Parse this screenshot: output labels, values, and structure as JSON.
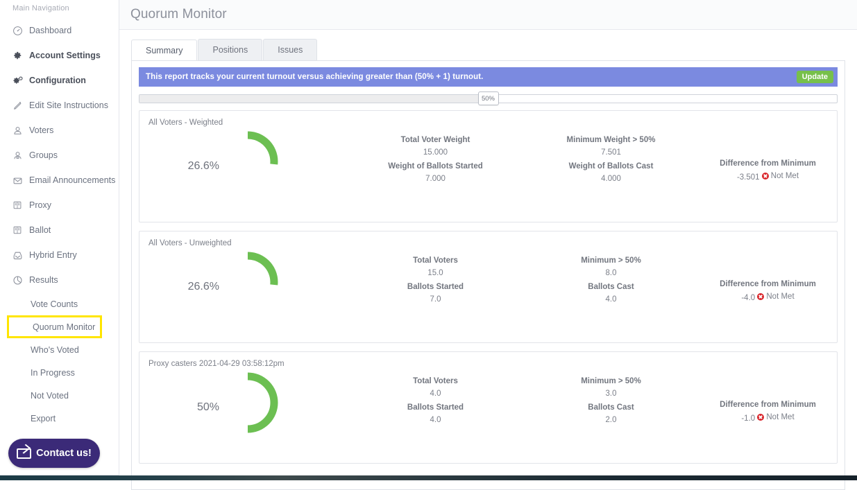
{
  "sidebar": {
    "heading": "Main Navigation",
    "items": [
      {
        "label": "Dashboard",
        "icon": "gauge-icon"
      },
      {
        "label": "Account Settings",
        "icon": "gear-icon"
      },
      {
        "label": "Configuration",
        "icon": "gears-icon"
      },
      {
        "label": "Edit Site Instructions",
        "icon": "pencil-icon"
      },
      {
        "label": "Voters",
        "icon": "user-icon"
      },
      {
        "label": "Groups",
        "icon": "users-icon"
      },
      {
        "label": "Email Announcements",
        "icon": "envelope-icon"
      },
      {
        "label": "Proxy",
        "icon": "book-icon"
      },
      {
        "label": "Ballot",
        "icon": "book-icon"
      },
      {
        "label": "Hybrid Entry",
        "icon": "inbox-icon"
      },
      {
        "label": "Results",
        "icon": "pie-chart-icon"
      }
    ],
    "sub_items": [
      {
        "label": "Vote Counts",
        "highlighted": false
      },
      {
        "label": "Quorum Monitor",
        "highlighted": true
      },
      {
        "label": "Who's Voted",
        "highlighted": false
      },
      {
        "label": "In Progress",
        "highlighted": false
      },
      {
        "label": "Not Voted",
        "highlighted": false
      },
      {
        "label": "Export",
        "highlighted": false
      }
    ],
    "contact_button": {
      "label": "Contact us!",
      "icon": "envelope-icon",
      "color": "#3b2a78"
    }
  },
  "header": {
    "title": "Quorum Monitor"
  },
  "tabs": [
    {
      "label": "Summary",
      "active": true
    },
    {
      "label": "Positions",
      "active": false
    },
    {
      "label": "Issues",
      "active": false
    }
  ],
  "banner": {
    "text": "This report tracks your current turnout versus achieving greater than (50% + 1) turnout.",
    "background": "#7b8ae0",
    "update_label": "Update",
    "update_color": "#77c04b"
  },
  "threshold_slider": {
    "value_label": "50%",
    "value": 50,
    "min": 0,
    "max": 100
  },
  "cards": [
    {
      "title": "All Voters - Weighted",
      "gauge": {
        "percent_label": "26.6%",
        "percent": 26.6,
        "color": "#6cbf52"
      },
      "stats_col1": [
        {
          "key": "Total Voter Weight",
          "value": "15.000"
        },
        {
          "key": "Weight of Ballots Started",
          "value": "7.000"
        }
      ],
      "stats_col2": [
        {
          "key": "Minimum Weight > 50%",
          "value": "7.501"
        },
        {
          "key": "Weight of Ballots Cast",
          "value": "4.000"
        }
      ],
      "difference": {
        "key": "Difference from Minimum",
        "value": "-3.501",
        "status": "Not Met",
        "status_icon": "x-circle-icon",
        "status_color": "#d9242a"
      }
    },
    {
      "title": "All Voters - Unweighted",
      "gauge": {
        "percent_label": "26.6%",
        "percent": 26.6,
        "color": "#6cbf52"
      },
      "stats_col1": [
        {
          "key": "Total Voters",
          "value": "15.0"
        },
        {
          "key": "Ballots Started",
          "value": "7.0"
        }
      ],
      "stats_col2": [
        {
          "key": "Minimum > 50%",
          "value": "8.0"
        },
        {
          "key": "Ballots Cast",
          "value": "4.0"
        }
      ],
      "difference": {
        "key": "Difference from Minimum",
        "value": "-4.0",
        "status": "Not Met",
        "status_icon": "x-circle-icon",
        "status_color": "#d9242a"
      }
    },
    {
      "title": "Proxy casters 2021-04-29 03:58:12pm",
      "gauge": {
        "percent_label": "50%",
        "percent": 50,
        "color": "#6cbf52"
      },
      "stats_col1": [
        {
          "key": "Total Voters",
          "value": "4.0"
        },
        {
          "key": "Ballots Started",
          "value": "4.0"
        }
      ],
      "stats_col2": [
        {
          "key": "Minimum > 50%",
          "value": "3.0"
        },
        {
          "key": "Ballots Cast",
          "value": "2.0"
        }
      ],
      "difference": {
        "key": "Difference from Minimum",
        "value": "-1.0",
        "status": "Not Met",
        "status_icon": "x-circle-icon",
        "status_color": "#d9242a"
      }
    }
  ],
  "chart_data": {
    "type": "pie",
    "title": "Quorum turnout gauges",
    "charts": [
      {
        "name": "All Voters - Weighted",
        "value": 26.6,
        "max": 100,
        "unit": "%",
        "threshold": 50
      },
      {
        "name": "All Voters - Unweighted",
        "value": 26.6,
        "max": 100,
        "unit": "%",
        "threshold": 50
      },
      {
        "name": "Proxy casters 2021-04-29 03:58:12pm",
        "value": 50,
        "max": 100,
        "unit": "%",
        "threshold": 50
      }
    ],
    "legend": [],
    "grid": false
  }
}
